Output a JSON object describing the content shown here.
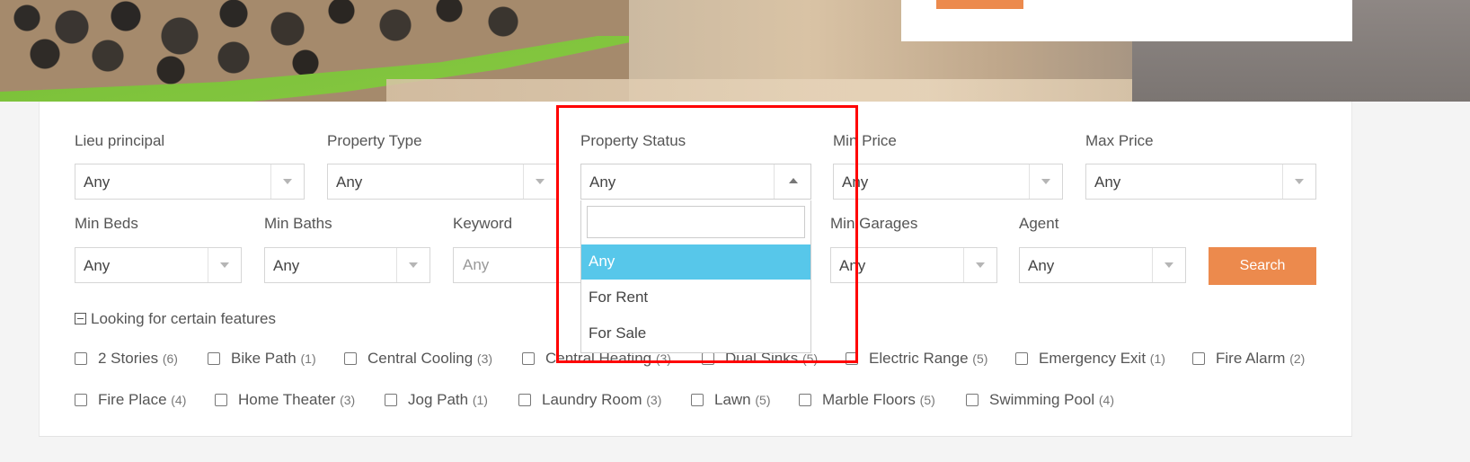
{
  "search": {
    "fields": [
      {
        "label": "Lieu principal",
        "value": "Any"
      },
      {
        "label": "Property Type",
        "value": "Any"
      },
      {
        "label": "Property Status",
        "value": "Any"
      },
      {
        "label": "Min Price",
        "value": "Any"
      },
      {
        "label": "Max Price",
        "value": "Any"
      },
      {
        "label": "Min Beds",
        "value": "Any"
      },
      {
        "label": "Min Baths",
        "value": "Any"
      },
      {
        "label": "Keyword",
        "placeholder": "Any"
      },
      {
        "label": "Min Garages",
        "value": "Any"
      },
      {
        "label": "Agent",
        "value": "Any"
      }
    ],
    "search_button": "Search",
    "features_toggle": "Looking for certain features"
  },
  "status_dropdown": {
    "options": [
      "Any",
      "For Rent",
      "For Sale"
    ],
    "selected": "Any"
  },
  "features": [
    {
      "label": "2 Stories",
      "count": "(6)"
    },
    {
      "label": "Bike Path",
      "count": "(1)"
    },
    {
      "label": "Central Cooling",
      "count": "(3)"
    },
    {
      "label": "Central Heating",
      "count": "(3)"
    },
    {
      "label": "Dual Sinks",
      "count": "(5)"
    },
    {
      "label": "Electric Range",
      "count": "(5)"
    },
    {
      "label": "Emergency Exit",
      "count": "(1)"
    },
    {
      "label": "Fire Alarm",
      "count": "(2)"
    },
    {
      "label": "Fire Place",
      "count": "(4)"
    },
    {
      "label": "Home Theater",
      "count": "(3)"
    },
    {
      "label": "Jog Path",
      "count": "(1)"
    },
    {
      "label": "Laundry Room",
      "count": "(3)"
    },
    {
      "label": "Lawn",
      "count": "(5)"
    },
    {
      "label": "Marble Floors",
      "count": "(5)"
    },
    {
      "label": "Swimming Pool",
      "count": "(4)"
    }
  ],
  "colors": {
    "accent": "#ec8a4d",
    "dropdown_highlight": "#57c7ea",
    "annotation_box": "#ff0000"
  }
}
